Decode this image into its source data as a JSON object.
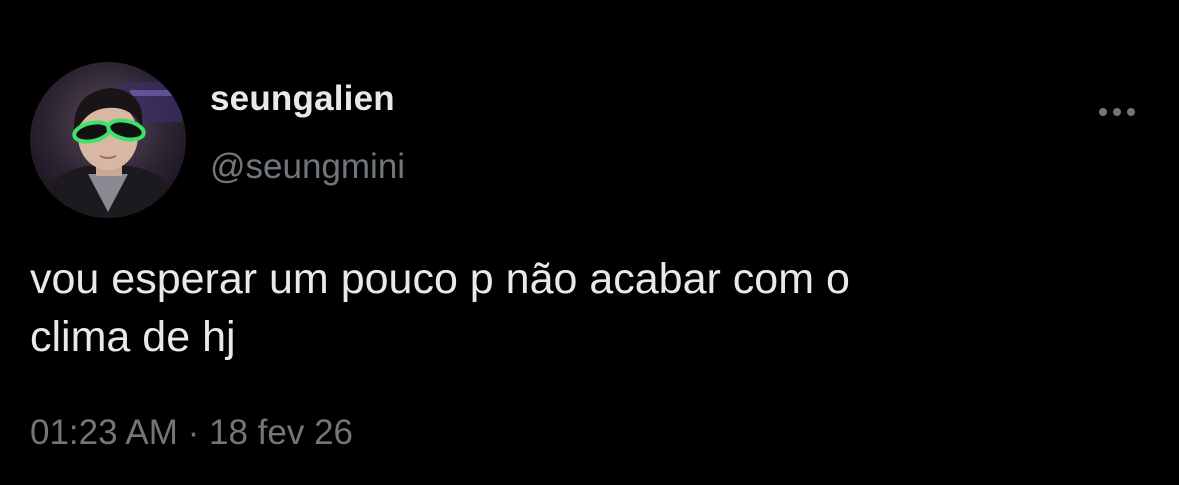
{
  "tweet": {
    "author": {
      "display_name": "seungalien",
      "handle": "@seungmini",
      "avatar_icon": "profile-photo"
    },
    "text": "vou esperar um pouco p não acabar com o\nclima de hj",
    "time": "01:23 AM",
    "separator": "·",
    "date": "18 fev 26",
    "more_icon": "more-horizontal-icon"
  },
  "colors": {
    "background": "#000000",
    "primary_text": "#e7e9ea",
    "secondary_text": "#71767b",
    "accent_green": "#3ee26a"
  }
}
